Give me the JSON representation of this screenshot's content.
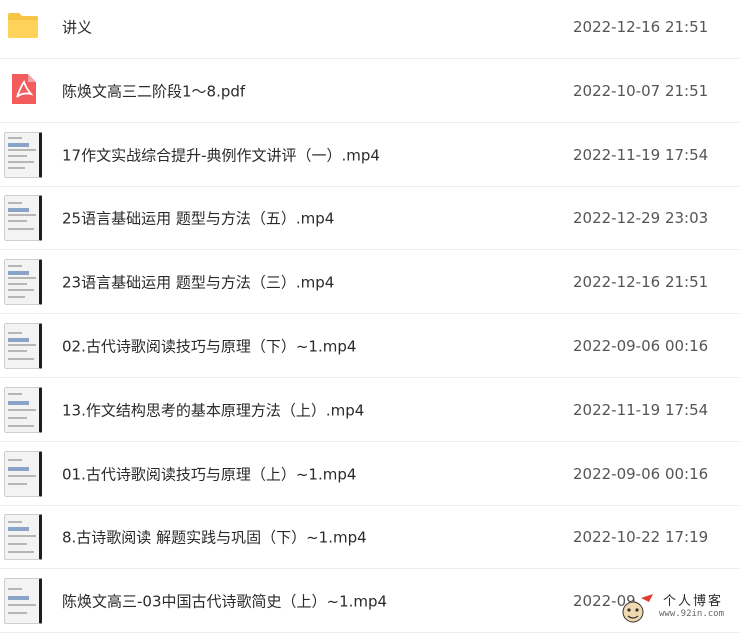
{
  "files": [
    {
      "name": "讲义",
      "date": "2022-12-16 21:51",
      "kind": "folder",
      "icon": "folder-icon"
    },
    {
      "name": "陈焕文高三二阶段1～8.pdf",
      "date": "2022-10-07 21:51",
      "kind": "pdf",
      "icon": "pdf-icon"
    },
    {
      "name": "17作文实战综合提升-典例作文讲评（一）.mp4",
      "date": "2022-11-19 17:54",
      "kind": "video",
      "icon": "video-thumbnail"
    },
    {
      "name": "25语言基础运用 题型与方法（五）.mp4",
      "date": "2022-12-29 23:03",
      "kind": "video",
      "icon": "video-thumbnail"
    },
    {
      "name": "23语言基础运用 题型与方法（三）.mp4",
      "date": "2022-12-16 21:51",
      "kind": "video",
      "icon": "video-thumbnail"
    },
    {
      "name": "02.古代诗歌阅读技巧与原理（下）~1.mp4",
      "date": "2022-09-06 00:16",
      "kind": "video",
      "icon": "video-thumbnail"
    },
    {
      "name": "13.作文结构思考的基本原理方法（上）.mp4",
      "date": "2022-11-19 17:54",
      "kind": "video",
      "icon": "video-thumbnail"
    },
    {
      "name": "01.古代诗歌阅读技巧与原理（上）~1.mp4",
      "date": "2022-09-06 00:16",
      "kind": "video",
      "icon": "video-thumbnail"
    },
    {
      "name": "8.古诗歌阅读 解题实践与巩固（下）~1.mp4",
      "date": "2022-10-22 17:19",
      "kind": "video",
      "icon": "video-thumbnail"
    },
    {
      "name": "陈焕文高三-03中国古代诗歌简史（上）~1.mp4",
      "date": "2022-09",
      "kind": "video",
      "icon": "video-thumbnail"
    }
  ],
  "watermark": {
    "title": "个人博客",
    "url": "www.92in.com"
  },
  "colors": {
    "folder": "#f7c544",
    "pdf": "#f25c5c",
    "text": "#2a2a2a",
    "date": "#555555",
    "divider": "#ececec"
  }
}
